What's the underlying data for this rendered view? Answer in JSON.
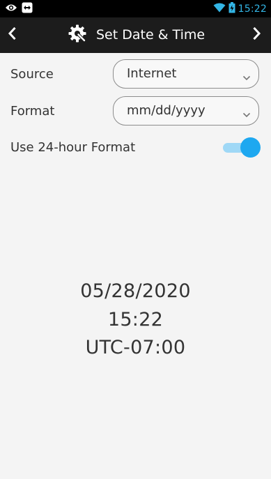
{
  "status_bar": {
    "left_icons": [
      "eye-icon",
      "remote-control-icon"
    ],
    "right_icons": [
      "wifi-icon",
      "battery-icon"
    ],
    "time": "15:22",
    "accent_color": "#33b5e5"
  },
  "header": {
    "title": "Set Date & Time",
    "back_icon": "chevron-left-icon",
    "forward_icon": "chevron-right-icon",
    "title_icon": "gear-wrench-icon",
    "background": "#1c1c1c"
  },
  "settings": {
    "source": {
      "label": "Source",
      "value": "Internet"
    },
    "format": {
      "label": "Format",
      "value": "mm/dd/yyyy"
    },
    "use_24_hour": {
      "label": "Use 24-hour Format",
      "enabled": true,
      "color": "#1ea8f0"
    }
  },
  "display": {
    "date": "05/28/2020",
    "time": "15:22",
    "timezone": "UTC-07:00"
  }
}
